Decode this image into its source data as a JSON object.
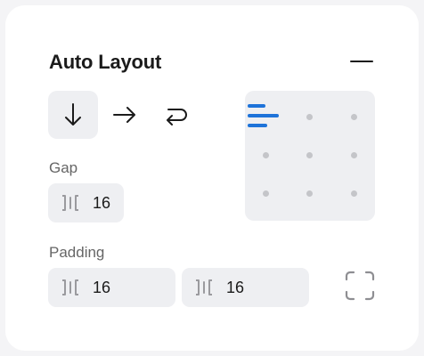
{
  "panel": {
    "title": "Auto Layout",
    "collapse_icon": "minus-icon"
  },
  "direction": {
    "options": [
      {
        "name": "vertical",
        "icon": "arrow-down-icon",
        "selected": true
      },
      {
        "name": "horizontal",
        "icon": "arrow-right-icon",
        "selected": false
      },
      {
        "name": "wrap",
        "icon": "wrap-icon",
        "selected": false
      }
    ]
  },
  "gap": {
    "label": "Gap",
    "icon": "gap-icon",
    "value": "16"
  },
  "padding": {
    "label": "Padding",
    "horizontal": {
      "icon": "padding-horizontal-icon",
      "value": "16"
    },
    "vertical": {
      "icon": "padding-vertical-icon",
      "value": "16"
    },
    "mode_icon": "padding-individual-icon"
  },
  "alignment": {
    "selected": "top-left",
    "accent_color": "#1e73d9",
    "dot_color": "#c4c5c9"
  }
}
